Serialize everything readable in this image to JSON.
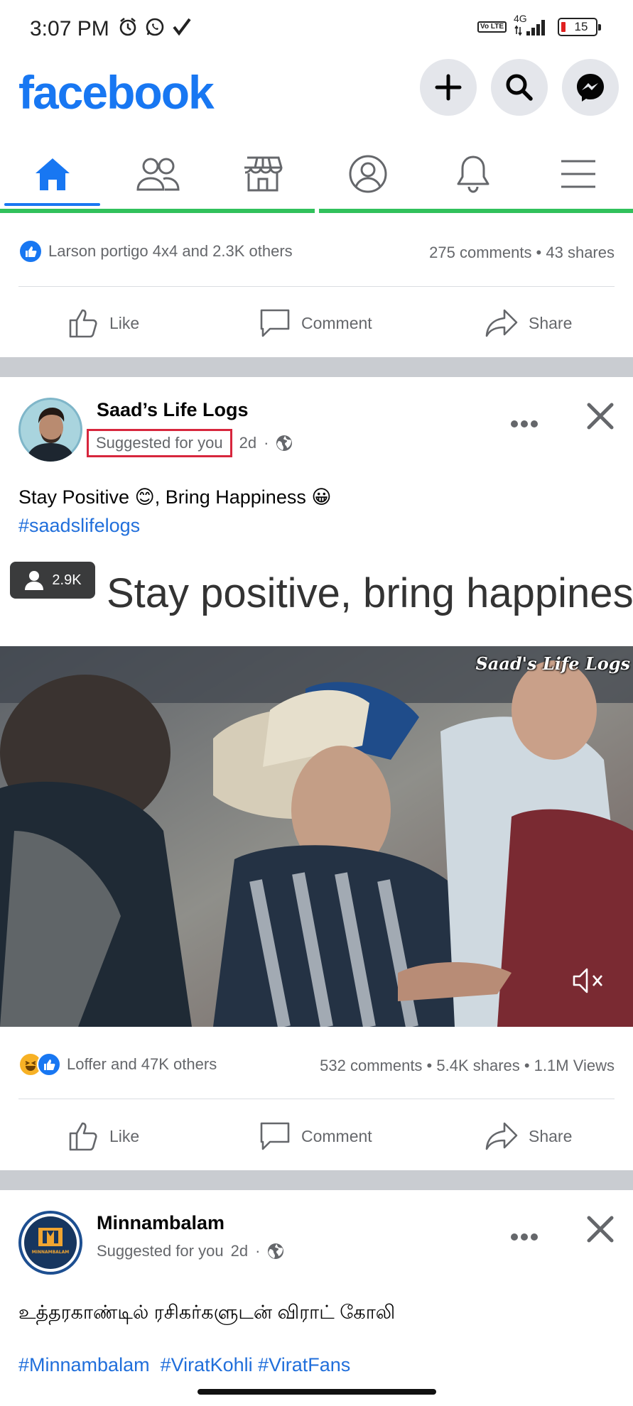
{
  "status_bar": {
    "time": "3:07 PM",
    "network": "4G",
    "volte": "Vo LTE",
    "battery": "15"
  },
  "header": {
    "logo": "facebook"
  },
  "tabs": [
    {
      "name": "home",
      "active": true
    },
    {
      "name": "friends",
      "active": false
    },
    {
      "name": "marketplace",
      "active": false
    },
    {
      "name": "profile",
      "active": false
    },
    {
      "name": "notifications",
      "active": false
    },
    {
      "name": "menu",
      "active": false
    }
  ],
  "prev_post": {
    "reactions_text": "Larson portigo 4x4 and 2.3K others",
    "comments_shares": "275 comments • 43 shares",
    "actions": {
      "like": "Like",
      "comment": "Comment",
      "share": "Share"
    }
  },
  "post1": {
    "author": "Saad’s Life Logs",
    "suggested": "Suggested for you",
    "time": "2d",
    "dot": "·",
    "text": "Stay Positive 😊, Bring Happiness 😀",
    "hashtag": "#saadslifelogs",
    "video_title": "Stay positive, bring happiness",
    "viewers": "2.9K",
    "watermark": "Saad's Life Logs",
    "reactions_text": "Loffer and 47K others",
    "stats": "532 comments • 5.4K shares • 1.1M Views",
    "actions": {
      "like": "Like",
      "comment": "Comment",
      "share": "Share"
    }
  },
  "post2": {
    "author": "Minnambalam",
    "suggested": "Suggested for you",
    "time": "2d",
    "dot": "·",
    "avatar_text": "MINNAMBALAM",
    "text": "உத்தரகாண்டில் ரசிகர்களுடன் விராட் கோலி",
    "hashtags": "#Minnambalam  #ViratKohli #ViratFans"
  },
  "colors": {
    "brand": "#1877f2",
    "progress": "#31c15c",
    "highlight": "#d7263d",
    "link": "#216fdb"
  }
}
